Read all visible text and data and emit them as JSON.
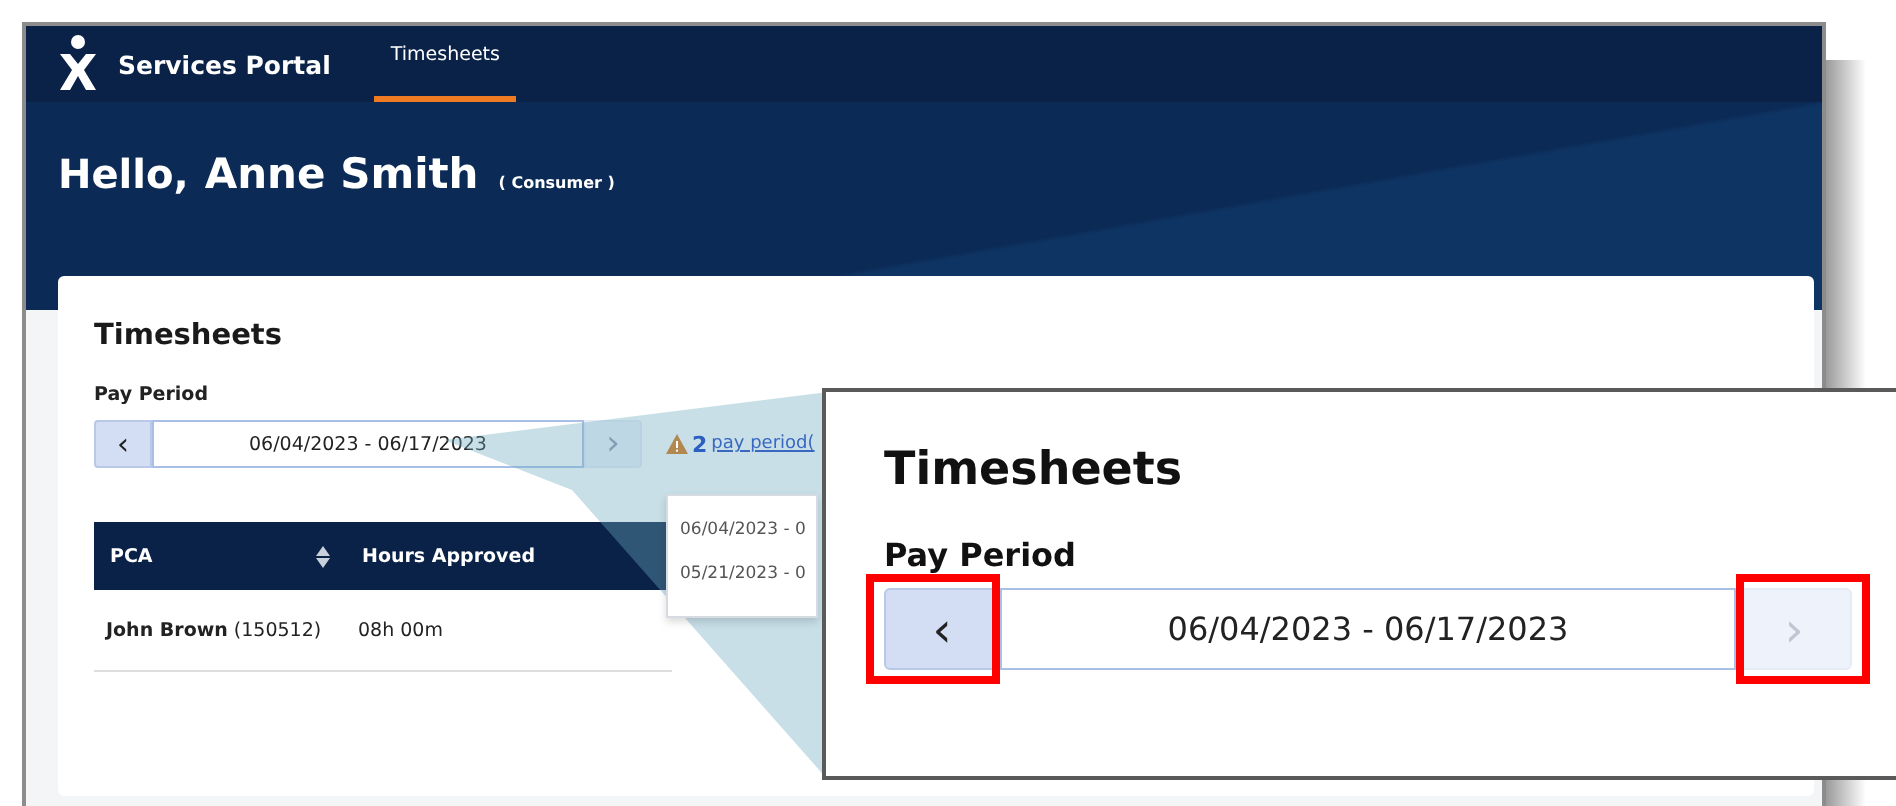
{
  "app": {
    "name": "Services Portal"
  },
  "nav": [
    {
      "label": "Timesheets",
      "selected": true
    }
  ],
  "greeting": {
    "hello": "Hello,",
    "name": "Anne Smith",
    "role": "( Consumer )"
  },
  "card": {
    "title": "Timesheets",
    "pay_period": {
      "label": "Pay Period",
      "prev": "‹",
      "range": "06/04/2023 - 06/17/2023",
      "next": "›",
      "next_disabled": true
    },
    "alert": {
      "count": "2",
      "link": "pay period("
    },
    "dropdown": [
      "06/04/2023 - 0",
      "05/21/2023 - 0"
    ],
    "table": {
      "columns": [
        {
          "label": "PCA",
          "sortable": true
        },
        {
          "label": "Hours Approved",
          "sortable": false
        }
      ],
      "rows": [
        {
          "name": "John Brown",
          "id": "(150512)",
          "hours": "08h 00m"
        }
      ]
    }
  },
  "callout": {
    "title": "Timesheets",
    "label": "Pay Period",
    "prev": "‹",
    "range": "06/04/2023 - 06/17/2023",
    "next": "›",
    "next_disabled": true,
    "highlight_prev": true,
    "highlight_next": true
  }
}
